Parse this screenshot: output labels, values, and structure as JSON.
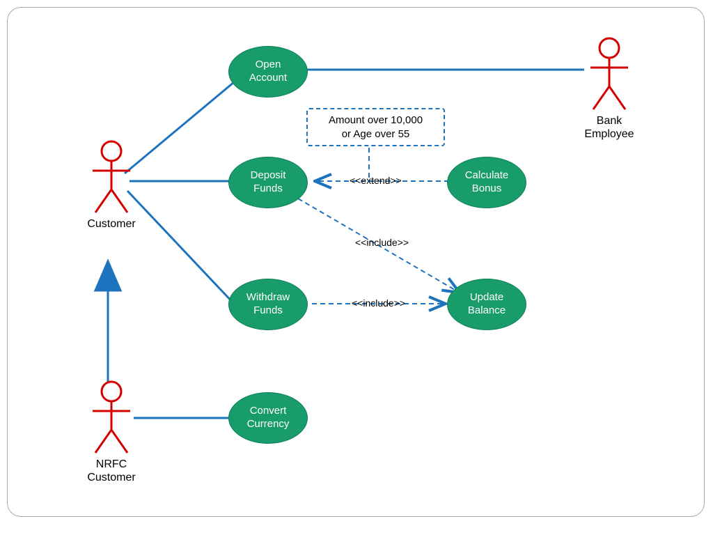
{
  "diagram_type": "UML Use Case Diagram",
  "actors": {
    "customer": "Customer",
    "nrfc_customer": "NRFC\nCustomer",
    "bank_employee": "Bank\nEmployee"
  },
  "usecases": {
    "open_account": "Open\nAccount",
    "deposit_funds": "Deposit\nFunds",
    "withdraw_funds": "Withdraw\nFunds",
    "convert_currency": "Convert\nCurrency",
    "calculate_bonus": "Calculate\nBonus",
    "update_balance": "Update\nBalance"
  },
  "note": "Amount over 10,000\nor Age over 55",
  "relationships": {
    "extend": "<<extend>>",
    "include": "<<include>>"
  },
  "edges": [
    {
      "from": "customer",
      "to": "open_account",
      "type": "association"
    },
    {
      "from": "customer",
      "to": "deposit_funds",
      "type": "association"
    },
    {
      "from": "customer",
      "to": "withdraw_funds",
      "type": "association"
    },
    {
      "from": "bank_employee",
      "to": "open_account",
      "type": "association"
    },
    {
      "from": "nrfc_customer",
      "to": "convert_currency",
      "type": "association"
    },
    {
      "from": "nrfc_customer",
      "to": "customer",
      "type": "generalization"
    },
    {
      "from": "calculate_bonus",
      "to": "deposit_funds",
      "type": "extend",
      "condition": "Amount over 10,000 or Age over 55"
    },
    {
      "from": "deposit_funds",
      "to": "update_balance",
      "type": "include"
    },
    {
      "from": "withdraw_funds",
      "to": "update_balance",
      "type": "include"
    }
  ]
}
